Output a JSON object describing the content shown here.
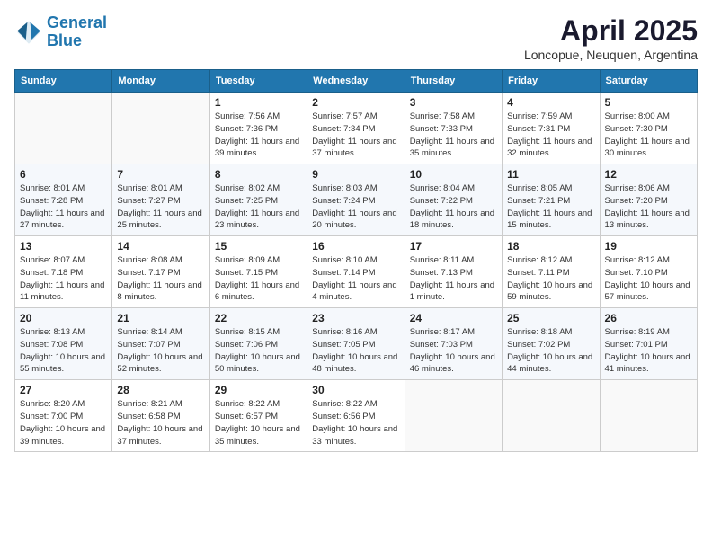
{
  "header": {
    "logo_line1": "General",
    "logo_line2": "Blue",
    "month": "April 2025",
    "location": "Loncopue, Neuquen, Argentina"
  },
  "days_of_week": [
    "Sunday",
    "Monday",
    "Tuesday",
    "Wednesday",
    "Thursday",
    "Friday",
    "Saturday"
  ],
  "weeks": [
    [
      {
        "day": "",
        "sunrise": "",
        "sunset": "",
        "daylight": ""
      },
      {
        "day": "",
        "sunrise": "",
        "sunset": "",
        "daylight": ""
      },
      {
        "day": "1",
        "sunrise": "Sunrise: 7:56 AM",
        "sunset": "Sunset: 7:36 PM",
        "daylight": "Daylight: 11 hours and 39 minutes."
      },
      {
        "day": "2",
        "sunrise": "Sunrise: 7:57 AM",
        "sunset": "Sunset: 7:34 PM",
        "daylight": "Daylight: 11 hours and 37 minutes."
      },
      {
        "day": "3",
        "sunrise": "Sunrise: 7:58 AM",
        "sunset": "Sunset: 7:33 PM",
        "daylight": "Daylight: 11 hours and 35 minutes."
      },
      {
        "day": "4",
        "sunrise": "Sunrise: 7:59 AM",
        "sunset": "Sunset: 7:31 PM",
        "daylight": "Daylight: 11 hours and 32 minutes."
      },
      {
        "day": "5",
        "sunrise": "Sunrise: 8:00 AM",
        "sunset": "Sunset: 7:30 PM",
        "daylight": "Daylight: 11 hours and 30 minutes."
      }
    ],
    [
      {
        "day": "6",
        "sunrise": "Sunrise: 8:01 AM",
        "sunset": "Sunset: 7:28 PM",
        "daylight": "Daylight: 11 hours and 27 minutes."
      },
      {
        "day": "7",
        "sunrise": "Sunrise: 8:01 AM",
        "sunset": "Sunset: 7:27 PM",
        "daylight": "Daylight: 11 hours and 25 minutes."
      },
      {
        "day": "8",
        "sunrise": "Sunrise: 8:02 AM",
        "sunset": "Sunset: 7:25 PM",
        "daylight": "Daylight: 11 hours and 23 minutes."
      },
      {
        "day": "9",
        "sunrise": "Sunrise: 8:03 AM",
        "sunset": "Sunset: 7:24 PM",
        "daylight": "Daylight: 11 hours and 20 minutes."
      },
      {
        "day": "10",
        "sunrise": "Sunrise: 8:04 AM",
        "sunset": "Sunset: 7:22 PM",
        "daylight": "Daylight: 11 hours and 18 minutes."
      },
      {
        "day": "11",
        "sunrise": "Sunrise: 8:05 AM",
        "sunset": "Sunset: 7:21 PM",
        "daylight": "Daylight: 11 hours and 15 minutes."
      },
      {
        "day": "12",
        "sunrise": "Sunrise: 8:06 AM",
        "sunset": "Sunset: 7:20 PM",
        "daylight": "Daylight: 11 hours and 13 minutes."
      }
    ],
    [
      {
        "day": "13",
        "sunrise": "Sunrise: 8:07 AM",
        "sunset": "Sunset: 7:18 PM",
        "daylight": "Daylight: 11 hours and 11 minutes."
      },
      {
        "day": "14",
        "sunrise": "Sunrise: 8:08 AM",
        "sunset": "Sunset: 7:17 PM",
        "daylight": "Daylight: 11 hours and 8 minutes."
      },
      {
        "day": "15",
        "sunrise": "Sunrise: 8:09 AM",
        "sunset": "Sunset: 7:15 PM",
        "daylight": "Daylight: 11 hours and 6 minutes."
      },
      {
        "day": "16",
        "sunrise": "Sunrise: 8:10 AM",
        "sunset": "Sunset: 7:14 PM",
        "daylight": "Daylight: 11 hours and 4 minutes."
      },
      {
        "day": "17",
        "sunrise": "Sunrise: 8:11 AM",
        "sunset": "Sunset: 7:13 PM",
        "daylight": "Daylight: 11 hours and 1 minute."
      },
      {
        "day": "18",
        "sunrise": "Sunrise: 8:12 AM",
        "sunset": "Sunset: 7:11 PM",
        "daylight": "Daylight: 10 hours and 59 minutes."
      },
      {
        "day": "19",
        "sunrise": "Sunrise: 8:12 AM",
        "sunset": "Sunset: 7:10 PM",
        "daylight": "Daylight: 10 hours and 57 minutes."
      }
    ],
    [
      {
        "day": "20",
        "sunrise": "Sunrise: 8:13 AM",
        "sunset": "Sunset: 7:08 PM",
        "daylight": "Daylight: 10 hours and 55 minutes."
      },
      {
        "day": "21",
        "sunrise": "Sunrise: 8:14 AM",
        "sunset": "Sunset: 7:07 PM",
        "daylight": "Daylight: 10 hours and 52 minutes."
      },
      {
        "day": "22",
        "sunrise": "Sunrise: 8:15 AM",
        "sunset": "Sunset: 7:06 PM",
        "daylight": "Daylight: 10 hours and 50 minutes."
      },
      {
        "day": "23",
        "sunrise": "Sunrise: 8:16 AM",
        "sunset": "Sunset: 7:05 PM",
        "daylight": "Daylight: 10 hours and 48 minutes."
      },
      {
        "day": "24",
        "sunrise": "Sunrise: 8:17 AM",
        "sunset": "Sunset: 7:03 PM",
        "daylight": "Daylight: 10 hours and 46 minutes."
      },
      {
        "day": "25",
        "sunrise": "Sunrise: 8:18 AM",
        "sunset": "Sunset: 7:02 PM",
        "daylight": "Daylight: 10 hours and 44 minutes."
      },
      {
        "day": "26",
        "sunrise": "Sunrise: 8:19 AM",
        "sunset": "Sunset: 7:01 PM",
        "daylight": "Daylight: 10 hours and 41 minutes."
      }
    ],
    [
      {
        "day": "27",
        "sunrise": "Sunrise: 8:20 AM",
        "sunset": "Sunset: 7:00 PM",
        "daylight": "Daylight: 10 hours and 39 minutes."
      },
      {
        "day": "28",
        "sunrise": "Sunrise: 8:21 AM",
        "sunset": "Sunset: 6:58 PM",
        "daylight": "Daylight: 10 hours and 37 minutes."
      },
      {
        "day": "29",
        "sunrise": "Sunrise: 8:22 AM",
        "sunset": "Sunset: 6:57 PM",
        "daylight": "Daylight: 10 hours and 35 minutes."
      },
      {
        "day": "30",
        "sunrise": "Sunrise: 8:22 AM",
        "sunset": "Sunset: 6:56 PM",
        "daylight": "Daylight: 10 hours and 33 minutes."
      },
      {
        "day": "",
        "sunrise": "",
        "sunset": "",
        "daylight": ""
      },
      {
        "day": "",
        "sunrise": "",
        "sunset": "",
        "daylight": ""
      },
      {
        "day": "",
        "sunrise": "",
        "sunset": "",
        "daylight": ""
      }
    ]
  ]
}
